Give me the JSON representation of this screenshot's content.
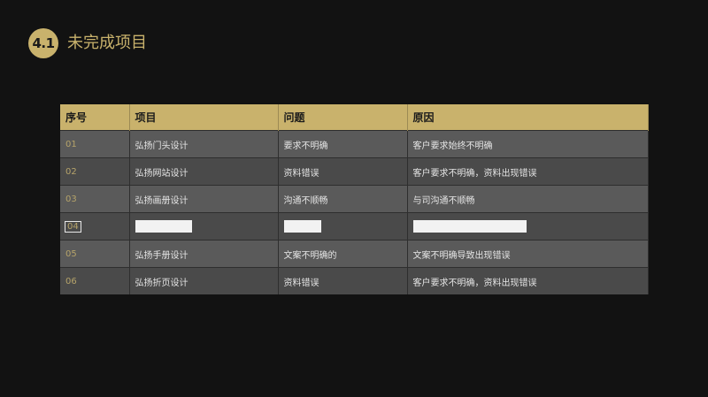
{
  "section": {
    "number": "4.1",
    "title": "未完成项目"
  },
  "table": {
    "headers": [
      "序号",
      "项目",
      "问题",
      "原因"
    ],
    "rows": [
      [
        "01",
        "弘扬门头设计",
        "要求不明确",
        "客户要求始终不明确"
      ],
      [
        "02",
        "弘扬网站设计",
        "资料错误",
        "客户要求不明确，资料出现错误"
      ],
      [
        "03",
        "弘扬画册设计",
        "沟通不顺畅",
        "与司沟通不顺畅"
      ],
      [
        "04",
        "",
        "",
        ""
      ],
      [
        "05",
        "弘扬手册设计",
        "文案不明确的",
        "文案不明确导致出现错误"
      ],
      [
        "06",
        "弘扬折页设计",
        "资料错误",
        "客户要求不明确，资料出现错误"
      ]
    ]
  },
  "colors": {
    "accent": "#c9b26c",
    "background": "#121212",
    "row_odd": "#5a5a5a",
    "row_even": "#4a4a4a"
  }
}
